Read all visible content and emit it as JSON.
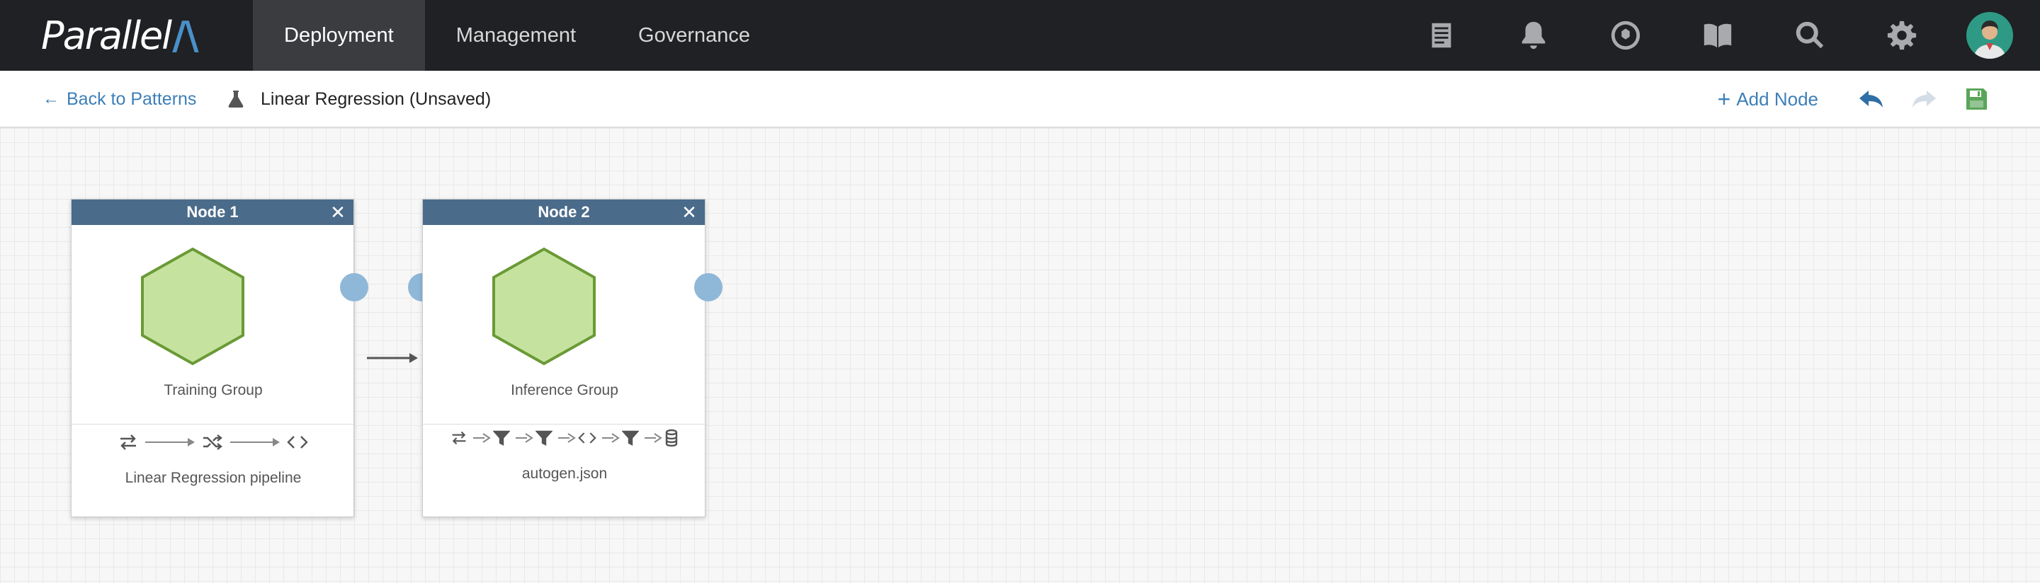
{
  "app": {
    "logo_text": "Parallel",
    "logo_accent": "/\\"
  },
  "nav": {
    "tabs": [
      {
        "label": "Deployment",
        "active": true
      },
      {
        "label": "Management",
        "active": false
      },
      {
        "label": "Governance",
        "active": false
      }
    ],
    "icons": [
      "log-icon",
      "bell-icon",
      "shutter-icon",
      "book-icon",
      "search-icon",
      "gear-icon",
      "user-avatar"
    ]
  },
  "subheader": {
    "back_label": "Back to Patterns",
    "pattern_title": "Linear Regression (Unsaved)",
    "add_node_label": "Add Node"
  },
  "nodes": [
    {
      "title": "Node 1",
      "group_label": "Training Group",
      "pipeline_label": "Linear Regression pipeline",
      "pipeline_icons": [
        "transform-icon",
        "shuffle-icon",
        "code-icon"
      ]
    },
    {
      "title": "Node 2",
      "group_label": "Inference Group",
      "pipeline_label": "autogen.json",
      "pipeline_icons": [
        "transform-icon",
        "filter-icon",
        "filter-icon",
        "code-icon",
        "filter-icon",
        "database-icon"
      ]
    }
  ],
  "colors": {
    "nav_bg": "#1f2124",
    "accent_blue": "#3d7fb8",
    "node_header": "#4b6b8a",
    "hex_fill": "#c5e39e",
    "hex_stroke": "#6a9a36",
    "save_green": "#5aa55a",
    "port": "#8fb7d8"
  }
}
